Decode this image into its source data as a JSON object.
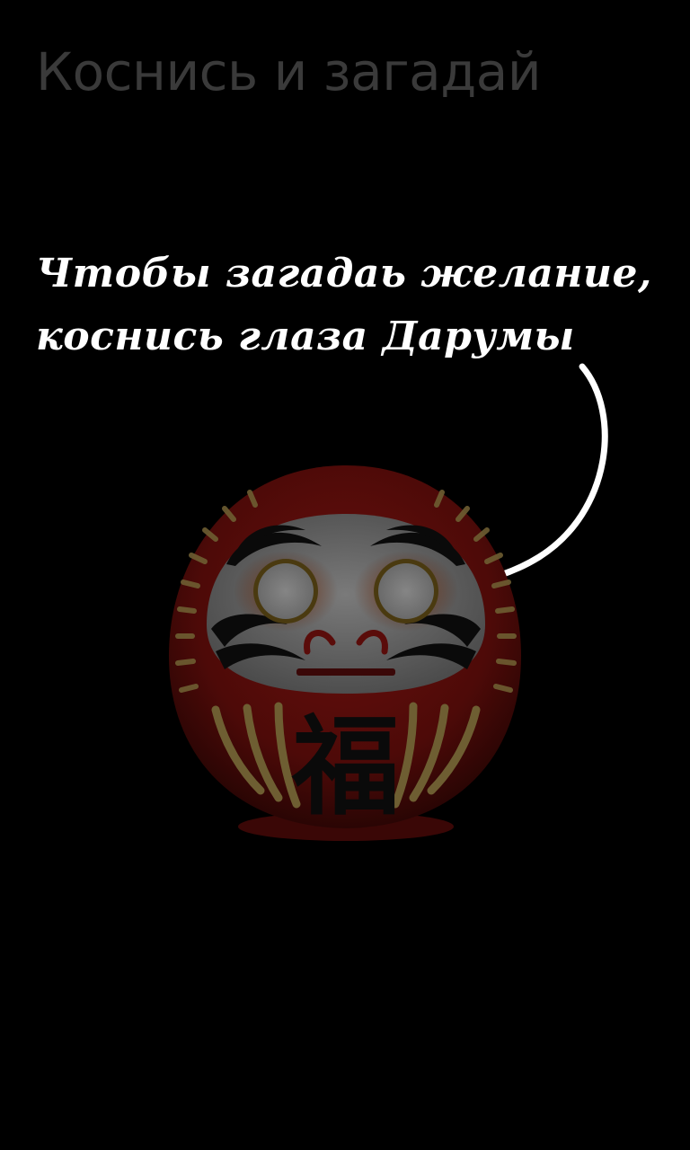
{
  "header": {
    "title": "Коснись и загадай"
  },
  "instruction": {
    "line1": "Чтобы загадаь желание,",
    "line2": "коснись глаза Дарумы"
  },
  "daruma": {
    "kanji": "福",
    "body_color": "#5a0c0a",
    "face_color": "#6e6e6e",
    "gold_color": "#7a6a3a"
  }
}
